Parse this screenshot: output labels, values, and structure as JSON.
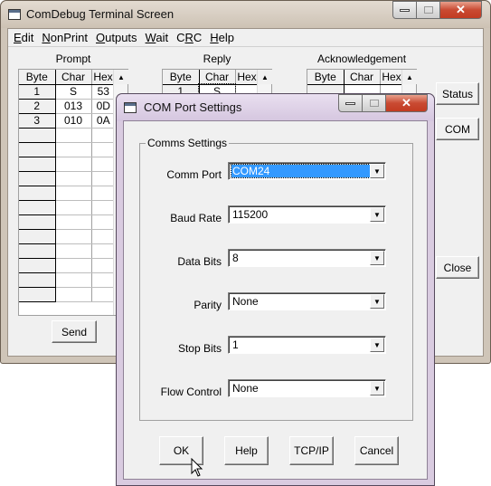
{
  "main_window": {
    "title": "ComDebug Terminal Screen",
    "menu": [
      {
        "label": "Edit",
        "accel": "E"
      },
      {
        "label": "NonPrint",
        "accel": "N"
      },
      {
        "label": "Outputs",
        "accel": "O"
      },
      {
        "label": "Wait",
        "accel": "W"
      },
      {
        "label": "CRC",
        "accel": "R"
      },
      {
        "label": "Help",
        "accel": "H"
      }
    ],
    "columns": [
      "Byte",
      "Char",
      "Hex"
    ],
    "prompt": {
      "label": "Prompt",
      "rows": [
        {
          "byte": "1",
          "char": "S",
          "hex": "53"
        },
        {
          "byte": "2",
          "char": "013",
          "hex": "0D"
        },
        {
          "byte": "3",
          "char": "010",
          "hex": "0A"
        }
      ]
    },
    "reply": {
      "label": "Reply",
      "rows": [
        {
          "byte": "1",
          "char": "S",
          "hex": ""
        }
      ]
    },
    "acknowledgement": {
      "label": "Acknowledgement",
      "rows": []
    },
    "buttons": {
      "status": "Status",
      "com": "COM",
      "close": "Close",
      "send": "Send"
    }
  },
  "dialog": {
    "title": "COM Port Settings",
    "group_label": "Comms Settings",
    "fields": {
      "comm_port": {
        "label": "Comm Port",
        "value": "COM24"
      },
      "baud_rate": {
        "label": "Baud Rate",
        "value": "115200"
      },
      "data_bits": {
        "label": "Data Bits",
        "value": "8"
      },
      "parity": {
        "label": "Parity",
        "value": "None"
      },
      "stop_bits": {
        "label": "Stop Bits",
        "value": "1"
      },
      "flow_control": {
        "label": "Flow Control",
        "value": "None"
      }
    },
    "buttons": {
      "ok": "OK",
      "help": "Help",
      "tcpip": "TCP/IP",
      "cancel": "Cancel"
    }
  },
  "icons": {
    "scroll_up": "▲",
    "dropdown": "▼",
    "close_glyph": "✕"
  }
}
